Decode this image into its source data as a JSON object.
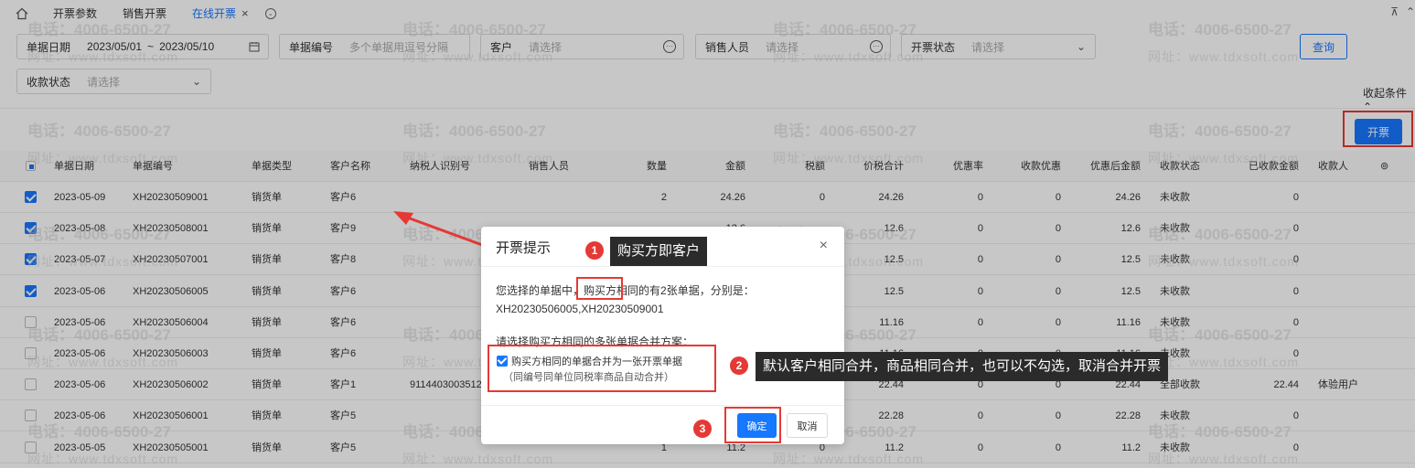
{
  "tabs": [
    {
      "label": "开票参数",
      "active": false
    },
    {
      "label": "销售开票",
      "active": false
    },
    {
      "label": "在线开票",
      "active": true
    }
  ],
  "tab_close_glyph": "×",
  "filters": {
    "date_label": "单据日期",
    "date_from": "2023/05/01",
    "date_sep": "~",
    "date_to": "2023/05/10",
    "docno_label": "单据编号",
    "docno_placeholder": "多个单据用逗号分隔",
    "customer_label": "客户",
    "customer_placeholder": "请选择",
    "salesperson_label": "销售人员",
    "salesperson_placeholder": "请选择",
    "invoice_status_label": "开票状态",
    "invoice_status_placeholder": "请选择",
    "payment_status_label": "收款状态",
    "payment_status_placeholder": "请选择",
    "query_button": "查询",
    "collapse_label": "收起条件"
  },
  "invoice_button": "开票",
  "table": {
    "headers": [
      "单据日期",
      "单据编号",
      "单据类型",
      "客户名称",
      "纳税人识别号",
      "销售人员",
      "数量",
      "金额",
      "税额",
      "价税合计",
      "优惠率",
      "收款优惠",
      "优惠后金额",
      "收款状态",
      "已收款金额",
      "收款人"
    ],
    "rows": [
      {
        "checked": true,
        "cells": [
          "2023-05-09",
          "XH20230509001",
          "销货单",
          "客户6",
          "",
          "",
          "2",
          "24.26",
          "0",
          "24.26",
          "0",
          "0",
          "24.26",
          "未收款",
          "0",
          "",
          ""
        ]
      },
      {
        "checked": true,
        "cells": [
          "2023-05-08",
          "XH20230508001",
          "销货单",
          "客户9",
          "",
          "",
          "",
          "12.6",
          "",
          "12.6",
          "0",
          "0",
          "12.6",
          "未收款",
          "0",
          "",
          ""
        ]
      },
      {
        "checked": true,
        "cells": [
          "2023-05-07",
          "XH20230507001",
          "销货单",
          "客户8",
          "",
          "",
          "",
          "",
          "",
          "12.5",
          "0",
          "0",
          "12.5",
          "未收款",
          "0",
          "",
          ""
        ]
      },
      {
        "checked": true,
        "cells": [
          "2023-05-06",
          "XH20230506005",
          "销货单",
          "客户6",
          "",
          "",
          "",
          "",
          "",
          "12.5",
          "0",
          "0",
          "12.5",
          "未收款",
          "0",
          "",
          ""
        ]
      },
      {
        "checked": false,
        "cells": [
          "2023-05-06",
          "XH20230506004",
          "销货单",
          "客户6",
          "",
          "",
          "",
          "",
          "",
          "11.16",
          "0",
          "0",
          "11.16",
          "未收款",
          "0",
          "",
          ""
        ]
      },
      {
        "checked": false,
        "cells": [
          "2023-05-06",
          "XH20230506003",
          "销货单",
          "客户6",
          "",
          "",
          "",
          "",
          "",
          "11.16",
          "0",
          "0",
          "11.16",
          "未收款",
          "0",
          "",
          ""
        ]
      },
      {
        "checked": false,
        "cells": [
          "2023-05-06",
          "XH20230506002",
          "销货单",
          "客户1",
          "9114403003512",
          "",
          "",
          "",
          "",
          "22.44",
          "0",
          "0",
          "22.44",
          "全部收款",
          "22.44",
          "体验用户",
          ""
        ]
      },
      {
        "checked": false,
        "cells": [
          "2023-05-06",
          "XH20230506001",
          "销货单",
          "客户5",
          "",
          "",
          "",
          "",
          "",
          "22.28",
          "0",
          "0",
          "22.28",
          "未收款",
          "0",
          "",
          ""
        ]
      },
      {
        "checked": false,
        "cells": [
          "2023-05-05",
          "XH20230505001",
          "销货单",
          "客户5",
          "",
          "",
          "1",
          "11.2",
          "0",
          "11.2",
          "0",
          "0",
          "11.2",
          "未收款",
          "0",
          "",
          ""
        ]
      }
    ]
  },
  "dialog": {
    "title": "开票提示",
    "close": "×",
    "line1_prefix": "您选择的单据中",
    "line1_highlight": "购买方",
    "line1_suffix": "相同的有2张单据，分别是：",
    "codes": "XH20230506005,XH20230509001",
    "prompt": "请选择购买方相同的多张单据合并方案：",
    "option_label": "购买方相同的单据合并为一张开票单据",
    "option_sub": "（同编号同单位同税率商品自动合并）",
    "option_checked": true,
    "ok": "确定",
    "cancel": "取消"
  },
  "annotations": [
    {
      "num": "1",
      "text": "购买方即客户"
    },
    {
      "num": "2",
      "text": "默认客户相同合并，商品相同合并，也可以不勾选，取消合并开票"
    },
    {
      "num": "3",
      "text": ""
    }
  ],
  "watermark": {
    "phone": "电话：4006-6500-27",
    "site": "网址：www.tdxsoft.com"
  },
  "colors": {
    "accent": "#1677ff",
    "annotation_red": "#e53935",
    "tooltip_bg": "#2b2b2b"
  }
}
